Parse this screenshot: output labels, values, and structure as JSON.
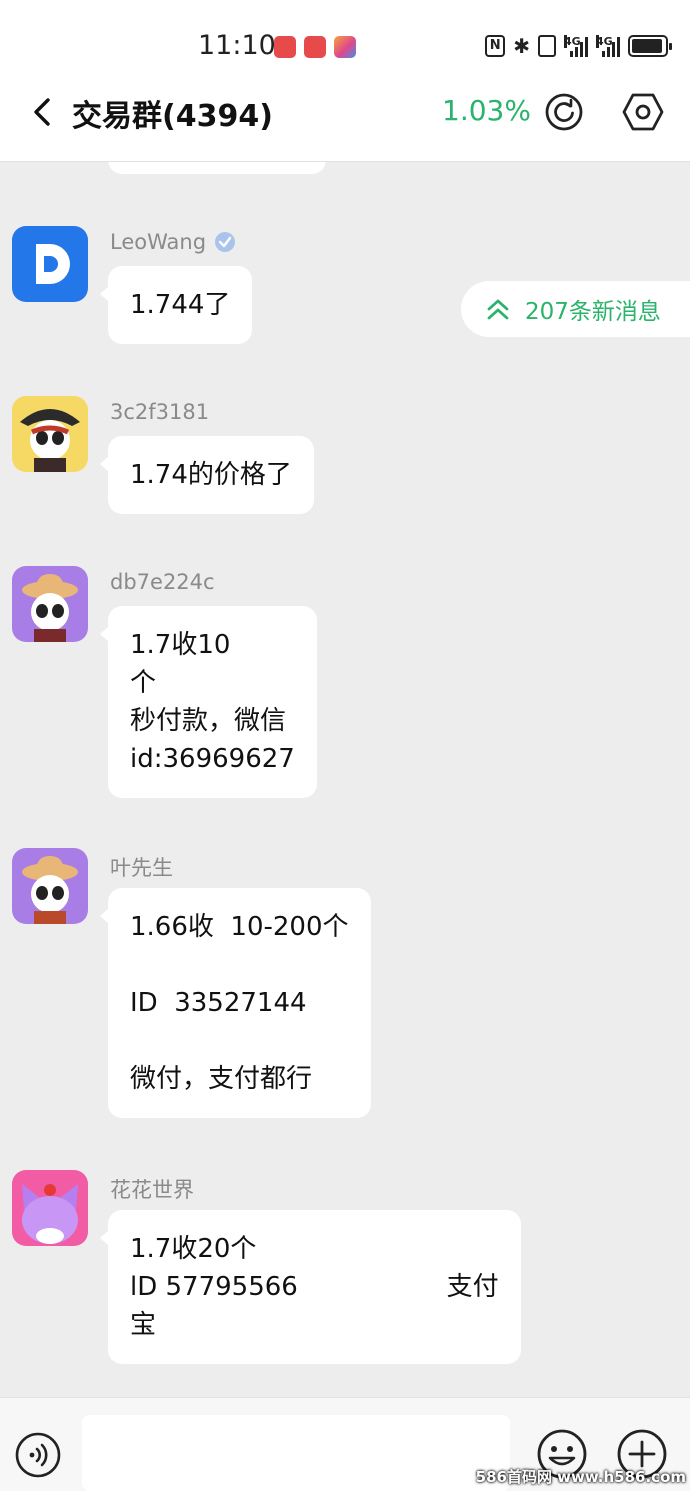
{
  "status_bar": {
    "time": "11:10",
    "nfc": "N",
    "network_1": "4G",
    "network_2": "4G"
  },
  "header": {
    "title": "交易群(4394)",
    "percent": "1.03%"
  },
  "new_messages": {
    "label": "207条新消息"
  },
  "messages": [
    {
      "sender": "LeoWang",
      "text": "1.744了",
      "verified": true
    },
    {
      "sender": "3c2f3181",
      "text": "1.74的价格了"
    },
    {
      "sender": "db7e224c",
      "text": "1.7收10\n个\n秒付款，微信\nid:36969627"
    },
    {
      "sender": "叶先生",
      "text": "1.66收  10-200个\n\nID  33527144\n\n微付，支付都行"
    },
    {
      "sender": "花花世界",
      "text": "1.7收20个\nlD 57795566                  支付\n宝"
    }
  ],
  "input": {
    "value": "",
    "placeholder": ""
  },
  "watermark": "586首码网 www.h586.com",
  "colors": {
    "accent": "#2ab36a",
    "background": "#ededed",
    "bubble": "#ffffff"
  },
  "icons": [
    "back-icon",
    "refresh-icon",
    "settings-icon",
    "verified-icon",
    "double-chevron-up-icon",
    "voice-icon",
    "emoji-icon",
    "plus-icon"
  ]
}
